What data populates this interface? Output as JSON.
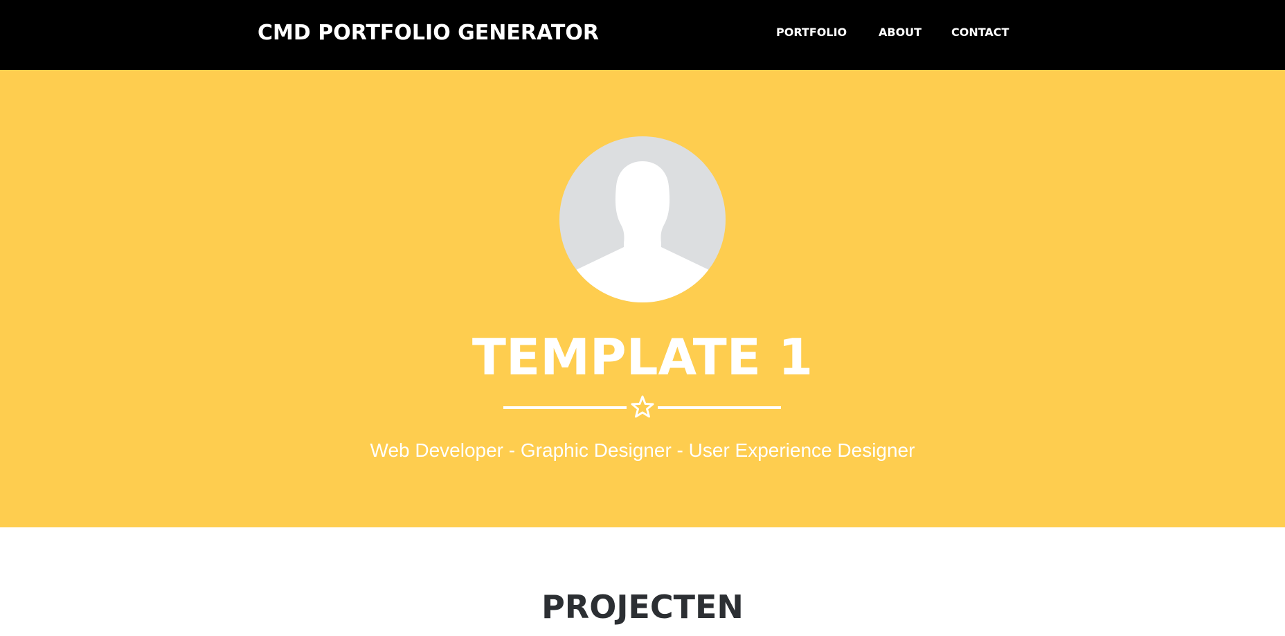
{
  "navbar": {
    "brand": "CMD PORTFOLIO GENERATOR",
    "links": [
      {
        "label": "PORTFOLIO"
      },
      {
        "label": "ABOUT"
      },
      {
        "label": "CONTACT"
      }
    ],
    "background": "#000000"
  },
  "hero": {
    "background": "#fecd4f",
    "avatar_icon": "user-silhouette-icon",
    "title": "TEMPLATE 1",
    "divider_icon": "star-outline-icon",
    "subtitle": "Web Developer - Graphic Designer - User Experience Designer"
  },
  "projects": {
    "title": "PROJECTEN"
  }
}
